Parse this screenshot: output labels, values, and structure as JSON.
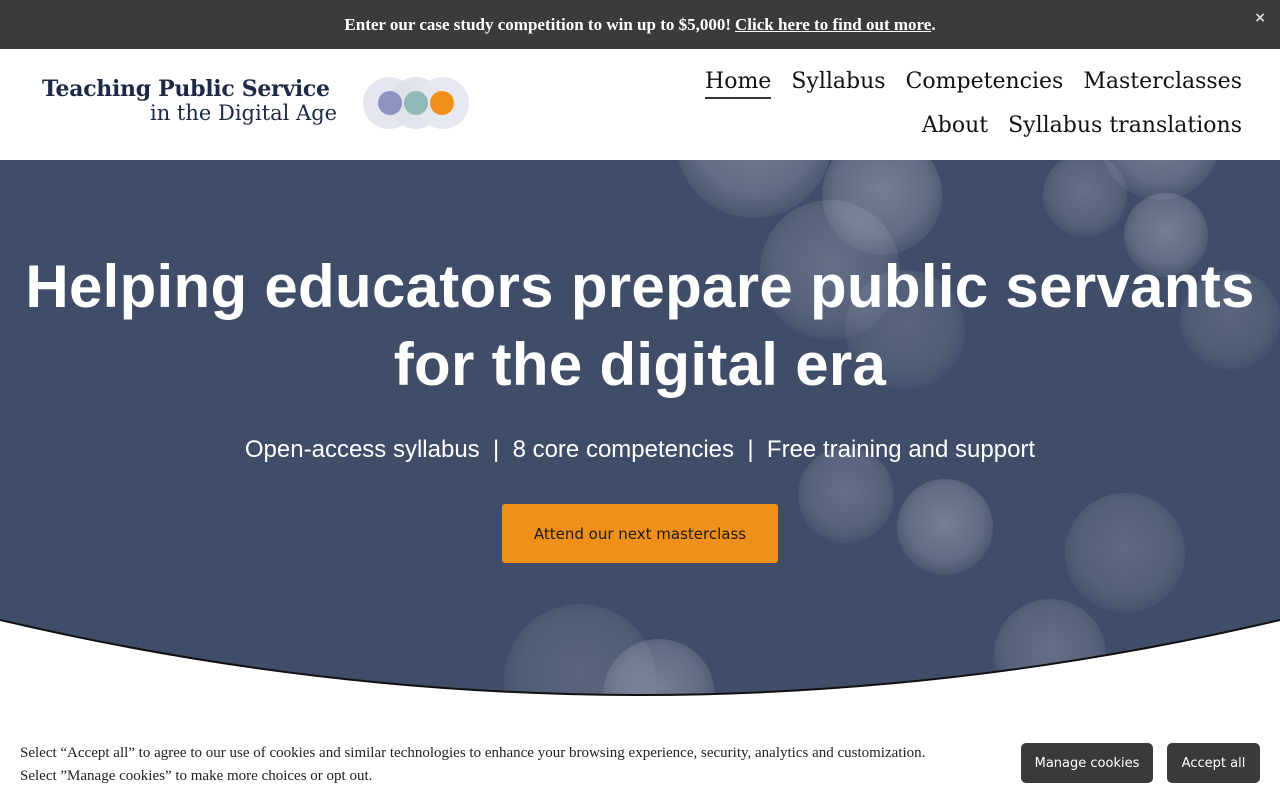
{
  "announcement": {
    "text": "Enter our case study competition to win up to $5,000!",
    "link_text": "Click here to find out more",
    "trailing": ".",
    "close_glyph": "×"
  },
  "header": {
    "logo_line1": "Teaching Public Service",
    "logo_line2": "in the Digital Age",
    "logo_circle_colors": [
      "#8e93c2",
      "#8fb8b8",
      "#f0901a"
    ],
    "nav": [
      {
        "label": "Home",
        "active": true
      },
      {
        "label": "Syllabus"
      },
      {
        "label": "Competencies"
      },
      {
        "label": "Masterclasses"
      },
      {
        "label": "About"
      },
      {
        "label": "Syllabus translations"
      }
    ]
  },
  "hero": {
    "title_line1": "Helping educators prepare public servants",
    "title_line2": "for the digital era",
    "subtitle": "Open-access syllabus  |  8 core competencies  |  Free training and support",
    "cta_label": "Attend our next masterclass",
    "background_color": "#3f4d69",
    "cta_color": "#f0901a"
  },
  "cookie_banner": {
    "line1": "Select “Accept all” to agree to our use of cookies and similar technologies to enhance your browsing experience, security, analytics and customization.",
    "line2": "Select ”Manage cookies” to make more choices or opt out.",
    "manage_label": "Manage cookies",
    "accept_label": "Accept all"
  }
}
